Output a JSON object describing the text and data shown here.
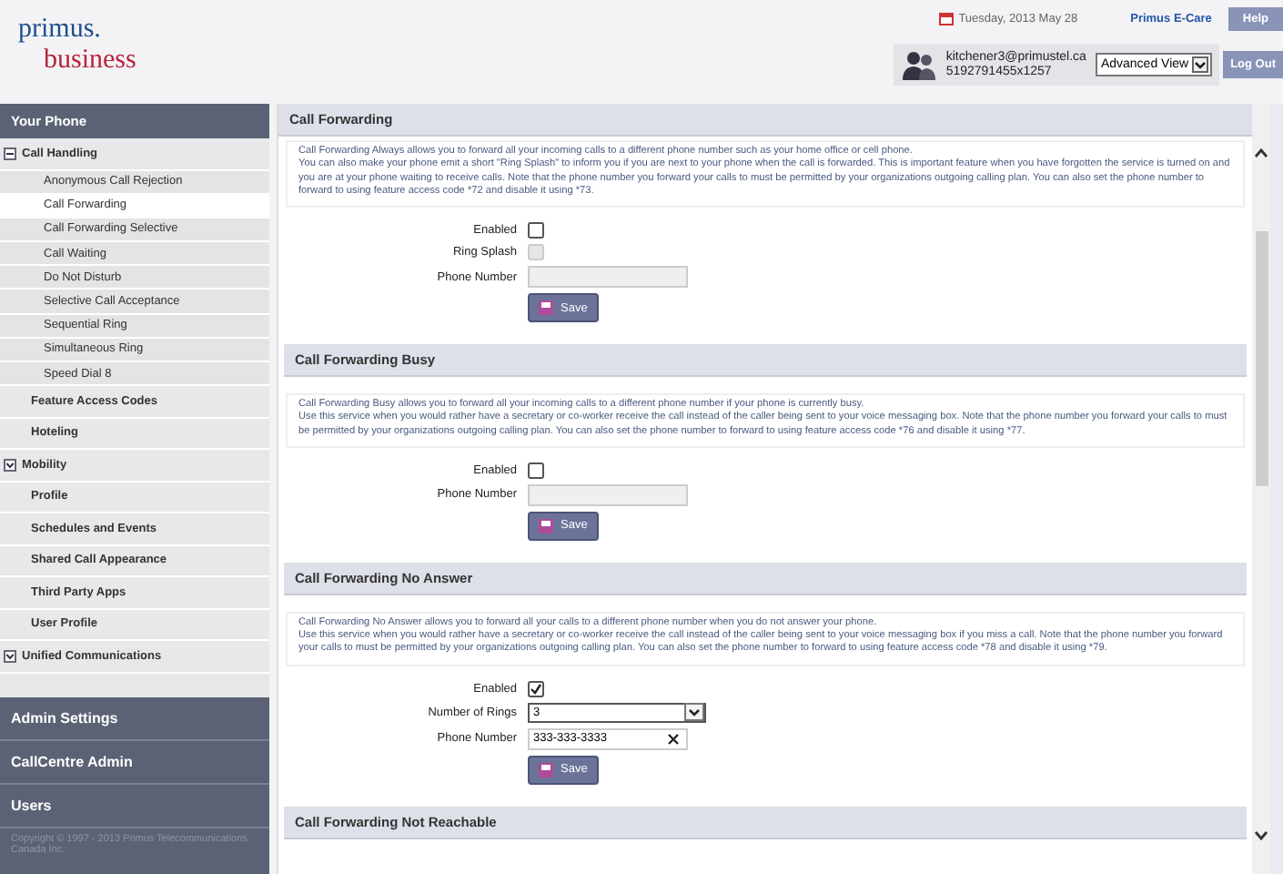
{
  "header": {
    "logo_top": "primus.",
    "logo_bottom": "business",
    "date": "Tuesday, 2013 May 28",
    "ecare_link": "Primus E-Care",
    "help_button": "Help",
    "user_email": "kitchener3@primustel.ca",
    "user_phone": "5192791455x1257",
    "view_select": "Advanced View",
    "logout_button": "Log Out"
  },
  "sidebar": {
    "title": "Your Phone",
    "items": [
      {
        "label": "Call Handling",
        "expanded": true,
        "selected": false,
        "children": [
          {
            "label": "Anonymous Call Rejection",
            "selected": false
          },
          {
            "label": "Call Forwarding",
            "selected": true
          },
          {
            "label": "Call Forwarding Selective",
            "selected": false
          },
          {
            "label": "Call Waiting",
            "selected": false
          },
          {
            "label": "Do Not Disturb",
            "selected": false
          },
          {
            "label": "Selective Call Acceptance",
            "selected": false
          },
          {
            "label": "Sequential Ring",
            "selected": false
          },
          {
            "label": "Simultaneous Ring",
            "selected": false
          },
          {
            "label": "Speed Dial 8",
            "selected": false
          }
        ]
      },
      {
        "label": "Feature Access Codes",
        "selected": false
      },
      {
        "label": "Hoteling",
        "selected": false
      },
      {
        "label": "Mobility",
        "expanded": false,
        "selected": false
      },
      {
        "label": "Profile",
        "selected": false
      },
      {
        "label": "Schedules and Events",
        "selected": false
      },
      {
        "label": "Shared Call Appearance",
        "selected": false
      },
      {
        "label": "Third Party Apps",
        "selected": false
      },
      {
        "label": "User Profile",
        "selected": false
      },
      {
        "label": "Unified Communications",
        "expanded": false,
        "selected": false
      }
    ],
    "sections": [
      "Admin Settings",
      "CallCentre Admin",
      "Users"
    ],
    "copyright": "Copyright © 1997 - 2013 Primus Telecommunications Canada Inc."
  },
  "sections": [
    {
      "title": "Call Forwarding",
      "description": [
        "Call Forwarding Always allows you to forward all your incoming calls to a different phone number such as your home office or cell phone.",
        "You can also make your phone emit a short \"Ring Splash\" to inform you if you are next to your phone when the call is forwarded. This is important feature when you have forgotten the service is turned on and you are at your phone waiting to receive calls. Note that the phone number you forward your calls to must be permitted by your organizations outgoing calling plan. You can also set the phone number to forward to using feature access code *72 and disable it using *73."
      ],
      "fields": [
        {
          "kind": "checkbox",
          "label": "Enabled",
          "checked": false,
          "disabled": false
        },
        {
          "kind": "checkbox",
          "label": "Ring Splash",
          "checked": false,
          "disabled": true
        },
        {
          "kind": "input",
          "label": "Phone Number",
          "disabled": true
        }
      ],
      "save": "Save"
    },
    {
      "title": "Call Forwarding Busy",
      "description": [
        "Call Forwarding Busy allows you to forward all your incoming calls to a different phone number if your phone is currently busy.",
        "Use this service when you would rather have a secretary or co-worker receive the call instead of the caller being sent to your voice messaging box. Note that the phone number you forward your calls to must be permitted by your organizations outgoing calling plan. You can also set the phone number to forward to using feature access code *76 and disable it using *77."
      ],
      "fields": [
        {
          "kind": "checkbox",
          "label": "Enabled",
          "checked": false,
          "disabled": false
        },
        {
          "kind": "input",
          "label": "Phone Number",
          "disabled": true
        }
      ],
      "save": "Save"
    },
    {
      "title": "Call Forwarding No Answer",
      "description": [
        "Call Forwarding No Answer allows you to forward all your calls to a different phone number when you do not answer your phone.",
        "Use this service when you would rather have a secretary or co-worker receive the call instead of the caller being sent to your voice messaging box if you miss a call. Note that the phone number you forward your calls to must be permitted by your organizations outgoing calling plan. You can also set the phone number to forward to using feature access code *78 and disable it using *79."
      ],
      "fields": [
        {
          "kind": "checkbox",
          "label": "Enabled",
          "checked": true,
          "disabled": false
        },
        {
          "kind": "select",
          "label": "Number of Rings",
          "value": "3"
        },
        {
          "kind": "input",
          "label": "Phone Number",
          "value": "333-333-3333",
          "disabled": false,
          "clearable": true
        }
      ],
      "save": "Save"
    },
    {
      "title": "Call Forwarding Not Reachable"
    }
  ]
}
